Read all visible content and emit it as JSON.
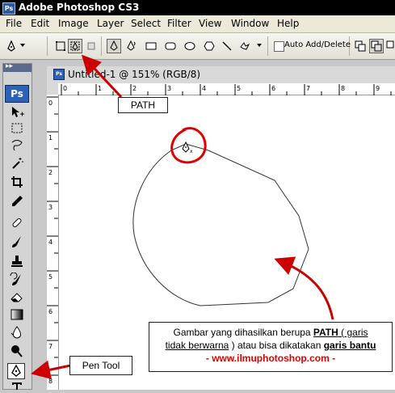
{
  "app": {
    "icon_label": "Ps",
    "title": "Adobe Photoshop CS3"
  },
  "menu": [
    "File",
    "Edit",
    "Image",
    "Layer",
    "Select",
    "Filter",
    "View",
    "Window",
    "Help"
  ],
  "options_bar": {
    "auto_add_delete_label": "Auto Add/Delete",
    "auto_add_delete_checked": false
  },
  "toolbox": {
    "logo": "Ps",
    "tools": [
      "move-tool",
      "marquee-tool",
      "lasso-tool",
      "magic-wand-tool",
      "crop-tool",
      "eyedropper-tool",
      "healing-brush-tool",
      "brush-tool",
      "clone-stamp-tool",
      "history-brush-tool",
      "eraser-tool",
      "gradient-tool",
      "blur-tool",
      "dodge-tool",
      "pen-tool",
      "type-tool"
    ],
    "active_tool": "pen-tool"
  },
  "document": {
    "icon_label": "Ps",
    "title": "Untitled-1 @ 151% (RGB/8)"
  },
  "rulers": {
    "horizontal": [
      "0",
      "1",
      "2",
      "3",
      "4",
      "5",
      "6",
      "7",
      "8",
      "9"
    ],
    "vertical": [
      "0",
      "1",
      "2",
      "3",
      "4",
      "5",
      "6",
      "7",
      "8"
    ]
  },
  "callouts": {
    "path_label": "PATH",
    "pen_tool_label": "Pen Tool",
    "description": {
      "line1_pre": "Gambar yang dihasilkan berupa ",
      "line1_path": "PATH",
      "line1_post": " ( garis",
      "line2_pre": "tidak berwarna",
      "line2_mid": " ) atau bisa dikatakan ",
      "line2_bold": "garis bantu",
      "line3": "- www.ilmuphotoshop.com -"
    }
  },
  "colors": {
    "title_bar": "#000000",
    "menu_bar": "#ece9d8",
    "annotation_red": "#e00000",
    "ps_blue": "#2c63b6"
  }
}
